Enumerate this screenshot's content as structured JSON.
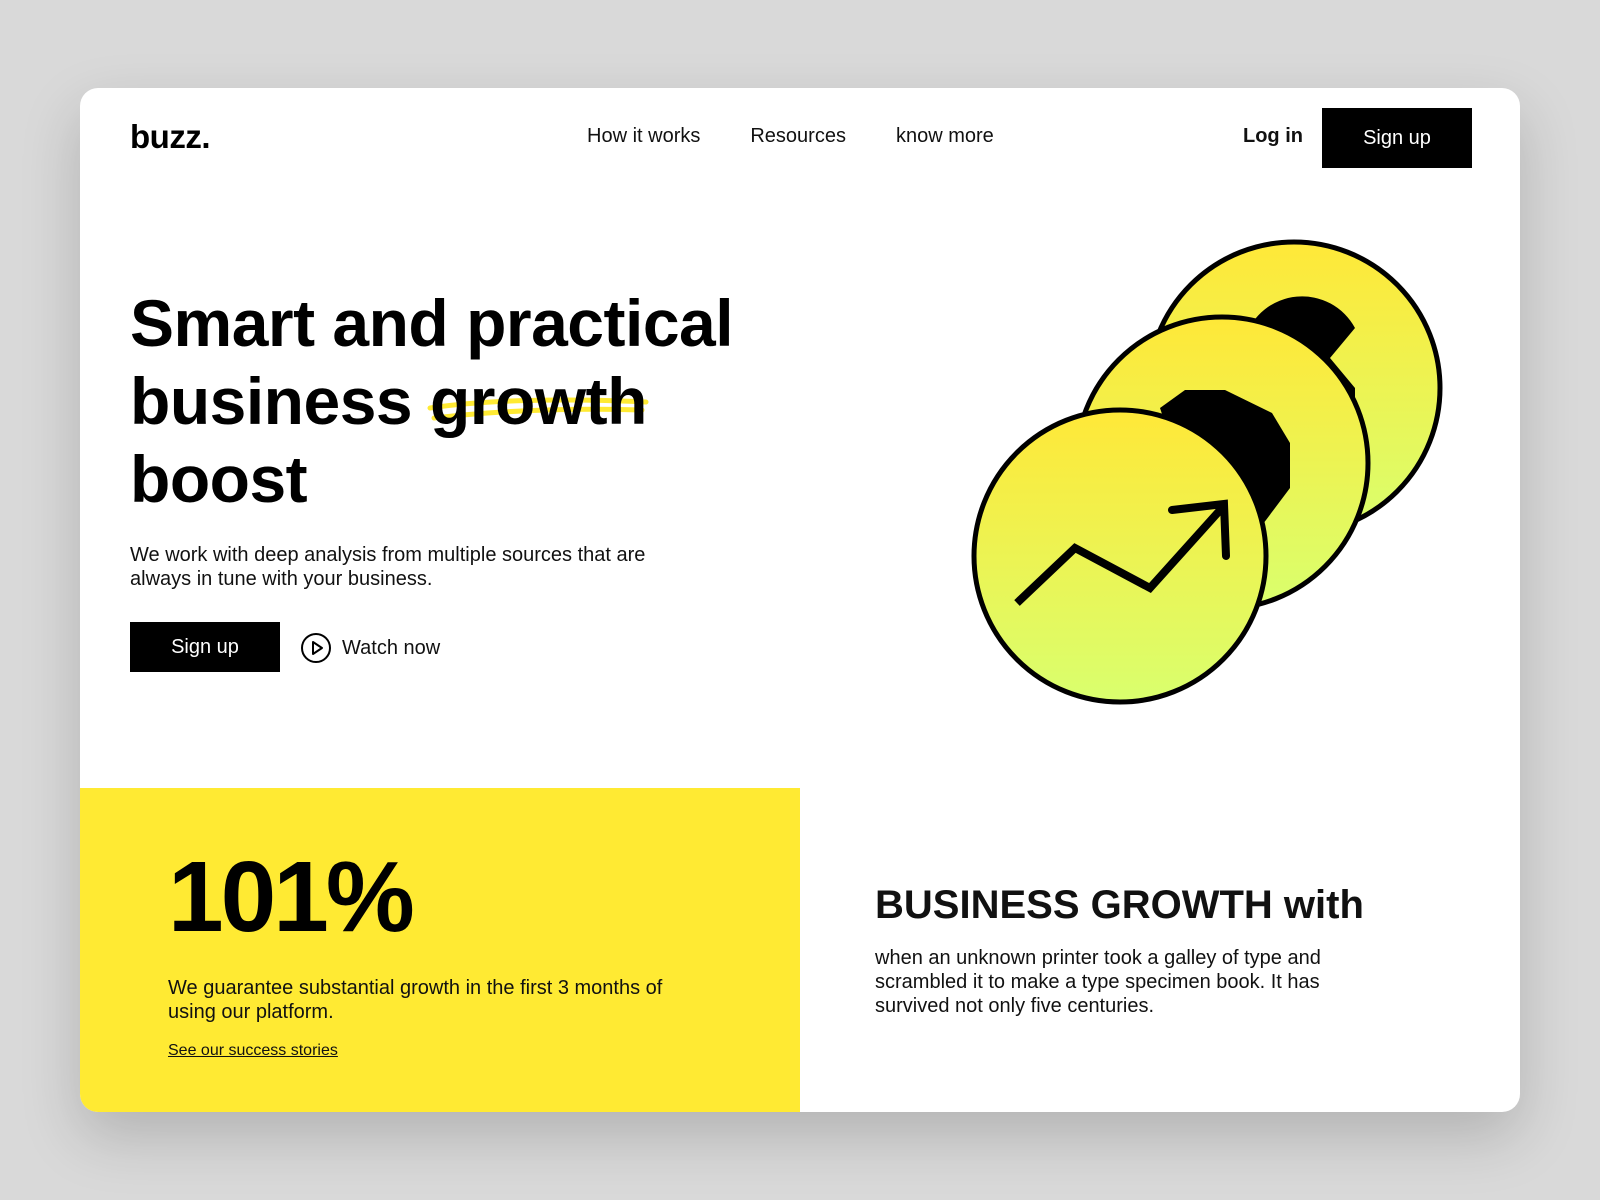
{
  "nav": {
    "logo": "buzz.",
    "links": [
      {
        "label": "How it works"
      },
      {
        "label": "Resources"
      },
      {
        "label": "know more"
      }
    ],
    "login_label": "Log in",
    "signup_label": "Sign up"
  },
  "hero": {
    "title_line1": "Smart and practical",
    "title_line2_a": "business ",
    "title_highlight": "growth",
    "title_line3": "boost",
    "subtitle": "We work with deep analysis from multiple sources that are always in tune with your business.",
    "signup_label": "Sign up",
    "watch_label": "Watch now"
  },
  "stats": {
    "number": "101%",
    "description": "We guarantee substantial growth in the first 3 months of using our platform.",
    "link_label": "See our success stories"
  },
  "growth": {
    "title_a": "BUSINESS ",
    "title_bold": "GROWTH",
    "title_b": " with",
    "description": "when an unknown printer took a galley of type and scrambled it to make a type specimen book. It has survived not only five centuries."
  },
  "colors": {
    "accent_yellow": "#ffea33",
    "coin_top": "#ffe838",
    "coin_bottom": "#d9ff6e",
    "background": "#d9d9d9"
  },
  "icons": {
    "play": "play-circle-icon",
    "chart": "trending-up-icon"
  }
}
